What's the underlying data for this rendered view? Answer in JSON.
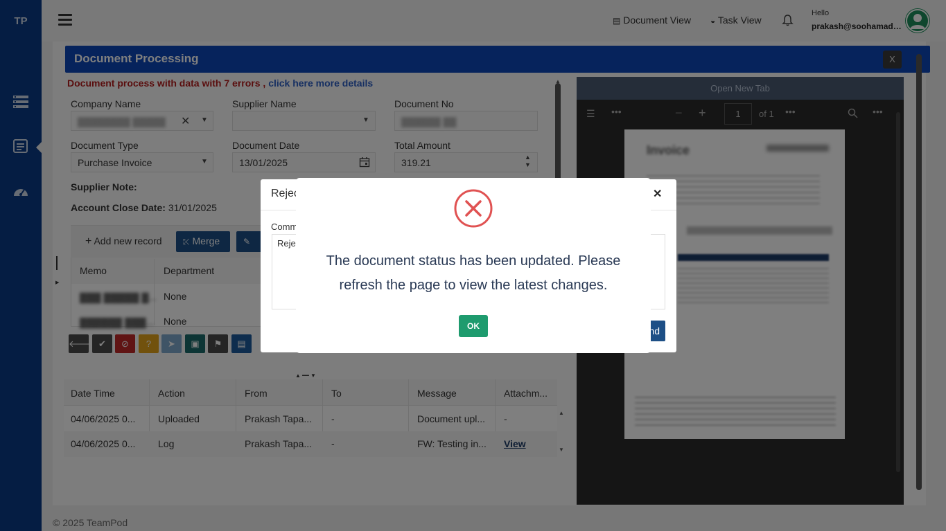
{
  "sidebar": {
    "logo": "TP"
  },
  "topbar": {
    "document_view_label": "Document View",
    "task_view_label": "Task View",
    "greeting": "Hello",
    "user_email": "prakash@soohamadmi..."
  },
  "panel": {
    "title": "Document Processing",
    "close_label": "X",
    "error_text": "Document process with data with 7 errors ,",
    "error_link": "click here more details"
  },
  "form": {
    "company_name_label": "Company Name",
    "supplier_name_label": "Supplier Name",
    "document_no_label": "Document No",
    "document_type_label": "Document Type",
    "document_type_value": "Purchase Invoice",
    "document_date_label": "Document Date",
    "document_date_value": "13/01/2025",
    "total_amount_label": "Total Amount",
    "total_amount_value": "319.21",
    "supplier_note_label": "Supplier Note:",
    "account_close_label": "Account Close Date:",
    "account_close_value": "31/01/2025"
  },
  "records": {
    "add_label": "Add new record",
    "merge_label": "Merge",
    "headers": [
      "Memo",
      "Department"
    ],
    "rows": [
      {
        "department": "None"
      },
      {
        "department": "None"
      }
    ]
  },
  "history": {
    "headers": [
      "Date Time",
      "Action",
      "From",
      "To",
      "Message",
      "Attachm..."
    ],
    "rows": [
      {
        "datetime": "04/06/2025 0...",
        "action": "Uploaded",
        "from": "Prakash Tapa...",
        "to": "-",
        "message": "Document upl...",
        "attachment": "-"
      },
      {
        "datetime": "04/06/2025 0...",
        "action": "Log",
        "from": "Prakash Tapa...",
        "to": "-",
        "message": "FW: Testing in...",
        "attachment": "View"
      }
    ]
  },
  "pdf": {
    "open_new_tab": "Open New Tab",
    "page_number": "1",
    "page_total": "of 1"
  },
  "background_dialog": {
    "title_partial": "Rejec",
    "comment_label_partial": "Comm",
    "comment_value_partial": "Reje",
    "send_partial": "nd"
  },
  "modal": {
    "message": "The document status has been updated. Please refresh the page to view the latest changes.",
    "ok_label": "OK"
  },
  "footer": {
    "copyright": "© 2025 TeamPod"
  },
  "colors": {
    "sidebar": "#0b3b86",
    "header": "#0d47b8",
    "error": "#b51c1c",
    "link": "#2d5fc4",
    "ok": "#1e9b6e",
    "x_icon": "#e05252"
  }
}
